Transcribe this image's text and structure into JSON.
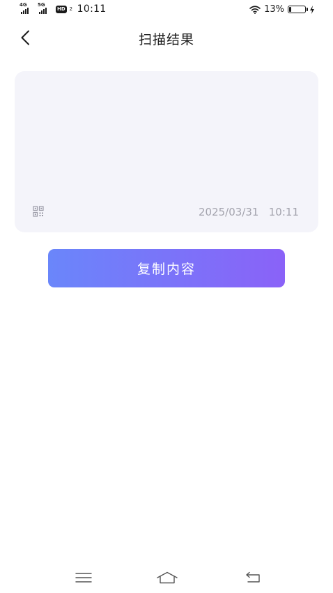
{
  "status_bar": {
    "net1_label": "4G",
    "net2_label": "5G",
    "hd_label": "HD",
    "hd_sub": "2",
    "time": "10:11",
    "battery_percent_text": "13%",
    "battery_level": 0.13
  },
  "header": {
    "back_icon": "chevron-left-icon",
    "title": "扫描结果"
  },
  "result": {
    "content": "",
    "scan_icon": "qr-code-icon",
    "timestamp": "2025/03/31   10:11"
  },
  "actions": {
    "copy_label": "复制内容"
  },
  "nav": {
    "menu_icon": "menu-icon",
    "home_icon": "home-icon",
    "back_icon": "back-arrow-icon"
  },
  "colors": {
    "accent_start": "#6a86fa",
    "accent_end": "#8a62f8",
    "card_bg": "#f4f4fa",
    "muted_text": "#a3a3ad"
  }
}
